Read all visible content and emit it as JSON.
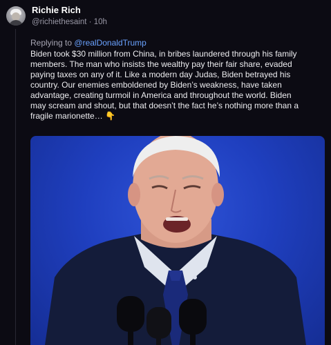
{
  "post": {
    "author": {
      "display_name": "Richie Rich",
      "handle": "@richiethesaint",
      "separator": "·",
      "time": "10h"
    },
    "reply": {
      "prefix": "Replying to",
      "mention": "@realDonaldTrump"
    },
    "body_lines": [
      "Biden took $30 million from China, in bribes laundered through his family",
      "members. The man who insists the wealthy pay their fair share, evaded",
      "paying taxes on any of it. Like a modern day Judas, Biden betrayed his",
      "country. Our enemies emboldened by Biden’s weakness, have taken",
      "advantage, creating  turmoil in America and throughout the world. Biden",
      "may scream and shout, but that doesn’t the fact he’s nothing more than a",
      "fragile marionette… 👇"
    ],
    "media": {
      "icon": "photo-of-man-speaking-at-microphones"
    }
  }
}
